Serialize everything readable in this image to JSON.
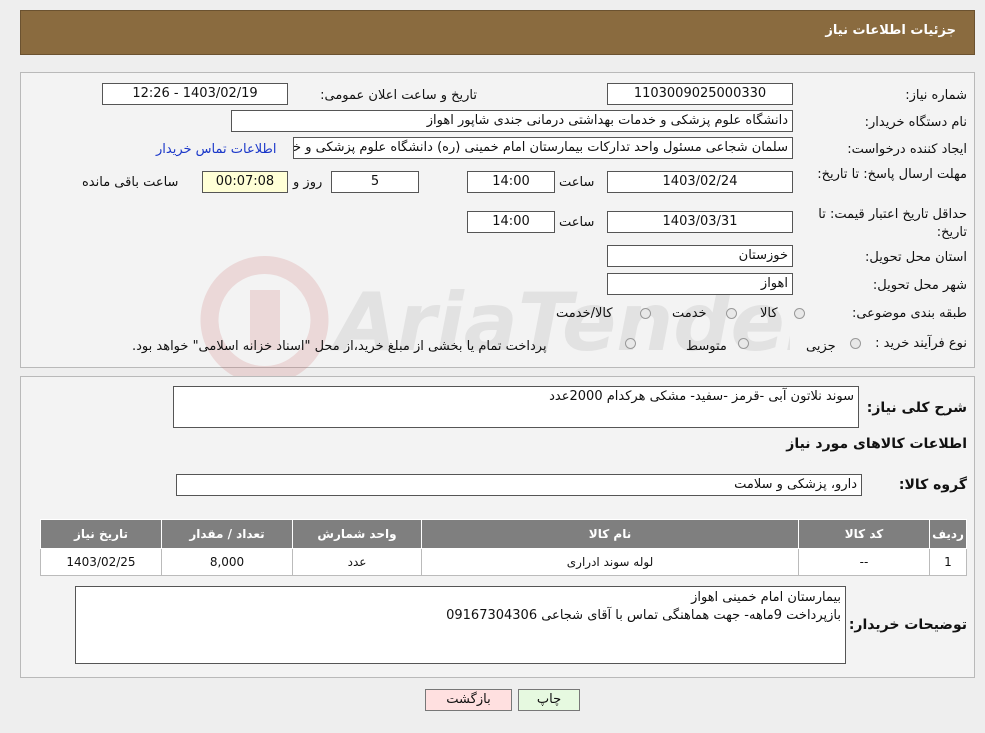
{
  "header": {
    "title": "جزئیات اطلاعات نیاز"
  },
  "form": {
    "need_number_label": "شماره نیاز:",
    "need_number": "1103009025000330",
    "announce_label": "تاریخ و ساعت اعلان عمومی:",
    "announce_value": "1403/02/19 - 12:26",
    "buyer_org_label": "نام دستگاه خریدار:",
    "buyer_org": "دانشگاه علوم پزشکی و خدمات بهداشتی درمانی جندی شاپور اهواز",
    "creator_label": "ایجاد کننده درخواست:",
    "creator": "سلمان شجاعی مسئول واحد تدارکات بیمارستان امام خمینی (ره) دانشگاه علوم پزشکی و خدمات بهداشتی درمانی جندی شاپور اهواز",
    "contact_link": "اطلاعات تماس خریدار",
    "deadline_label": "مهلت ارسال پاسخ: تا تاریخ:",
    "deadline_date": "1403/02/24",
    "time_label": "ساعت",
    "deadline_time": "14:00",
    "days": "5",
    "days_label": "روز و",
    "remaining": "00:07:08",
    "remaining_label": "ساعت باقی مانده",
    "validity_label": "حداقل تاریخ اعتبار قیمت: تا تاریخ:",
    "validity_date": "1403/03/31",
    "validity_time": "14:00",
    "province_label": "استان محل تحویل:",
    "province": "خوزستان",
    "city_label": "شهر محل تحویل:",
    "city": "اهواز",
    "category_label": "طبقه بندی موضوعی:",
    "category_options": [
      "کالا",
      "خدمت",
      "کالا/خدمت"
    ],
    "process_label": "نوع فرآیند خرید :",
    "process_options": [
      "جزیی",
      "متوسط"
    ],
    "process_note": "پرداخت تمام یا بخشی از مبلغ خرید،از محل \"اسناد خزانه اسلامی\" خواهد بود."
  },
  "details": {
    "summary_label": "شرح کلی نیاز:",
    "summary": "سوند نلاتون آبی -قرمز -سفید- مشکی   هرکدام 2000عدد",
    "goods_title": "اطلاعات کالاهای مورد نیاز",
    "group_label": "گروه کالا:",
    "group": "دارو، پزشکی و سلامت",
    "table": {
      "headers": [
        "ردیف",
        "کد کالا",
        "نام کالا",
        "واحد شمارش",
        "تعداد / مقدار",
        "تاریخ نیاز"
      ],
      "rows": [
        [
          "1",
          "--",
          "لوله سوند ادراری",
          "عدد",
          "8,000",
          "1403/02/25"
        ]
      ]
    },
    "notes_label": "توضیحات خریدار:",
    "notes_line1": "بیمارستان امام خمینی اهواز",
    "notes_line2": "بازپرداخت 9ماهه-  جهت هماهنگی تماس با آقای شجاعی 09167304306"
  },
  "buttons": {
    "print": "چاپ",
    "back": "بازگشت"
  },
  "colors": {
    "header_bg": "#8a6b3f",
    "link": "#1a37c9",
    "back_button_bg": "#ffe0e0",
    "print_button_bg": "#e6f9e0"
  }
}
